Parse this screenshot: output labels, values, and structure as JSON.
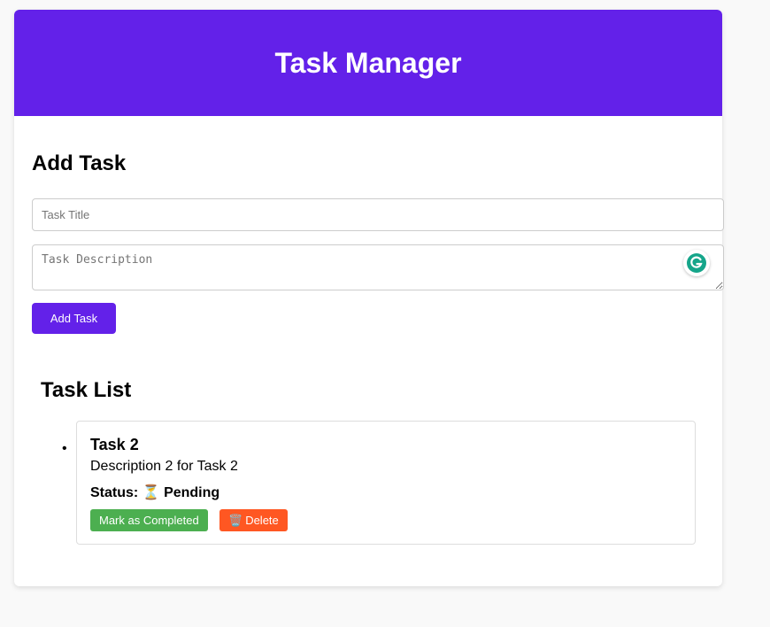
{
  "header": {
    "title": "Task Manager",
    "color": "#6321e9"
  },
  "add_task": {
    "heading": "Add Task",
    "title_placeholder": "Task Title",
    "title_value": "",
    "description_placeholder": "Task Description",
    "description_value": "",
    "submit_label": "Add Task",
    "extension_icon": "grammarly-icon"
  },
  "task_list": {
    "heading": "Task List",
    "tasks": [
      {
        "title": "Task 2",
        "description": "Description 2 for Task 2",
        "status_label": "Status:",
        "status_icon": "⏳",
        "status_value": "Pending",
        "complete_label": "Mark as Completed",
        "complete_color": "#4caf50",
        "delete_icon": "🗑️",
        "delete_label": "Delete",
        "delete_color": "#ff5722"
      }
    ]
  }
}
